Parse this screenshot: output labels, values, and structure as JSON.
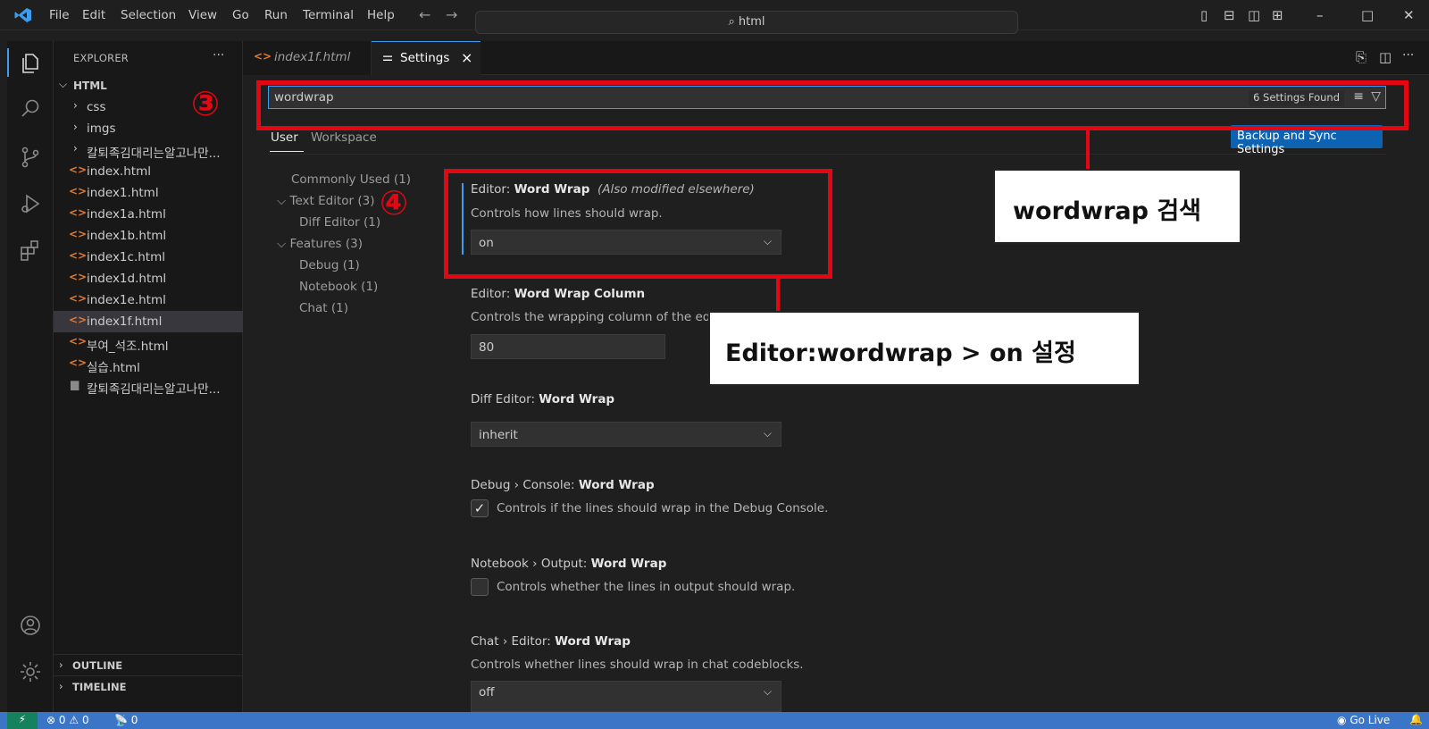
{
  "titlebar": {
    "menu": [
      "File",
      "Edit",
      "Selection",
      "View",
      "Go",
      "Run",
      "Terminal",
      "Help"
    ],
    "back_icon": "arrow-left-icon",
    "forward_icon": "arrow-right-icon",
    "command_center": "html",
    "command_center_icon": "search-icon"
  },
  "activitybar": {
    "items": [
      "explorer-icon",
      "search-icon",
      "source-control-icon",
      "run-debug-icon",
      "extensions-icon"
    ],
    "bottom": [
      "account-icon",
      "manage-gear-icon"
    ]
  },
  "sidebar": {
    "title": "EXPLORER",
    "more": "···",
    "folder": "HTML",
    "tree": [
      {
        "label": "css",
        "type": "folder"
      },
      {
        "label": "imgs",
        "type": "folder"
      },
      {
        "label": "칼퇴족김대리는알고나만...",
        "type": "folder"
      },
      {
        "label": "index.html",
        "type": "html"
      },
      {
        "label": "index1.html",
        "type": "html"
      },
      {
        "label": "index1a.html",
        "type": "html"
      },
      {
        "label": "index1b.html",
        "type": "html"
      },
      {
        "label": "index1c.html",
        "type": "html"
      },
      {
        "label": "index1d.html",
        "type": "html"
      },
      {
        "label": "index1e.html",
        "type": "html"
      },
      {
        "label": "index1f.html",
        "type": "html",
        "selected": true
      },
      {
        "label": "부여_석조.html",
        "type": "html"
      },
      {
        "label": "실습.html",
        "type": "html"
      },
      {
        "label": "칼퇴족김대리는알고나만...",
        "type": "file"
      }
    ],
    "outline": "OUTLINE",
    "timeline": "TIMELINE"
  },
  "tabs": [
    {
      "label": "index1f.html",
      "icon": "html-file-icon",
      "active": false
    },
    {
      "label": "Settings",
      "icon": "settings-sliders-icon",
      "active": true,
      "close": "×"
    }
  ],
  "settings": {
    "search_value": "wordwrap",
    "found": "6 Settings Found",
    "scope_tabs": [
      "User",
      "Workspace"
    ],
    "backup_button": "Backup and Sync Settings",
    "toc": [
      {
        "label": "Commonly Used",
        "count": "(1)"
      },
      {
        "label": "Text Editor",
        "count": "(3)"
      },
      {
        "label": "Diff Editor",
        "count": "(1)"
      },
      {
        "label": "Features",
        "count": "(3)"
      },
      {
        "label": "Debug",
        "count": "(1)"
      },
      {
        "label": "Notebook",
        "count": "(1)"
      },
      {
        "label": "Chat",
        "count": "(1)"
      }
    ],
    "items": [
      {
        "category": "Editor: ",
        "name": "Word Wrap",
        "note": "(Also modified elsewhere)",
        "desc": "Controls how lines should wrap.",
        "value": "on"
      },
      {
        "category": "Editor: ",
        "name": "Word Wrap Column",
        "desc": "Controls the wrapping column of the ed",
        "value": "80"
      },
      {
        "category": "Diff Editor: ",
        "name": "Word Wrap",
        "value": "inherit"
      },
      {
        "category": "Debug › Console: ",
        "name": "Word Wrap",
        "desc": "Controls if the lines should wrap in the Debug Console.",
        "checked": true
      },
      {
        "category": "Notebook › Output: ",
        "name": "Word Wrap",
        "desc": "Controls whether the lines in output should wrap.",
        "checked": false
      },
      {
        "category": "Chat › Editor: ",
        "name": "Word Wrap",
        "desc": "Controls whether lines should wrap in chat codeblocks.",
        "value": "off"
      }
    ]
  },
  "annotations": {
    "marker3": "③",
    "marker4": "④",
    "callout1": "wordwrap 검색",
    "callout2": "Editor:wordwrap > on 설정"
  },
  "statusbar": {
    "errors": "0",
    "warnings": "0",
    "ports": "0",
    "golive": "Go Live"
  },
  "colors": {
    "accent": "#3b9cf0",
    "annotation_red": "#e30613",
    "statusbar": "#3b75c7"
  }
}
